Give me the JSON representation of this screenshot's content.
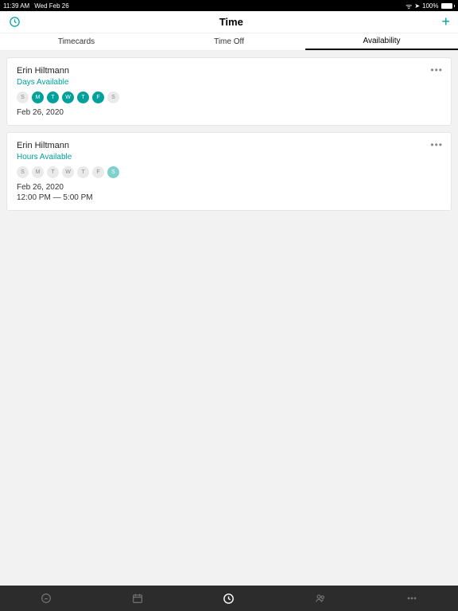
{
  "status": {
    "time": "11:39 AM",
    "date": "Wed Feb 26",
    "battery": "100%"
  },
  "nav": {
    "title": "Time"
  },
  "tabs": [
    {
      "label": "Timecards",
      "active": false
    },
    {
      "label": "Time Off",
      "active": false
    },
    {
      "label": "Availability",
      "active": true
    }
  ],
  "cards": [
    {
      "name": "Erin Hiltmann",
      "subtitle": "Days Available",
      "days": [
        "S",
        "M",
        "T",
        "W",
        "T",
        "F",
        "S"
      ],
      "active_days": [
        false,
        true,
        true,
        true,
        true,
        true,
        false
      ],
      "date": "Feb 26, 2020",
      "time": ""
    },
    {
      "name": "Erin Hiltmann",
      "subtitle": "Hours Available",
      "days": [
        "S",
        "M",
        "T",
        "W",
        "T",
        "F",
        "S"
      ],
      "active_days": [
        false,
        false,
        false,
        false,
        false,
        false,
        true
      ],
      "date": "Feb 26, 2020",
      "time": "12:00 PM — 5:00 PM"
    }
  ],
  "more_label": "•••"
}
